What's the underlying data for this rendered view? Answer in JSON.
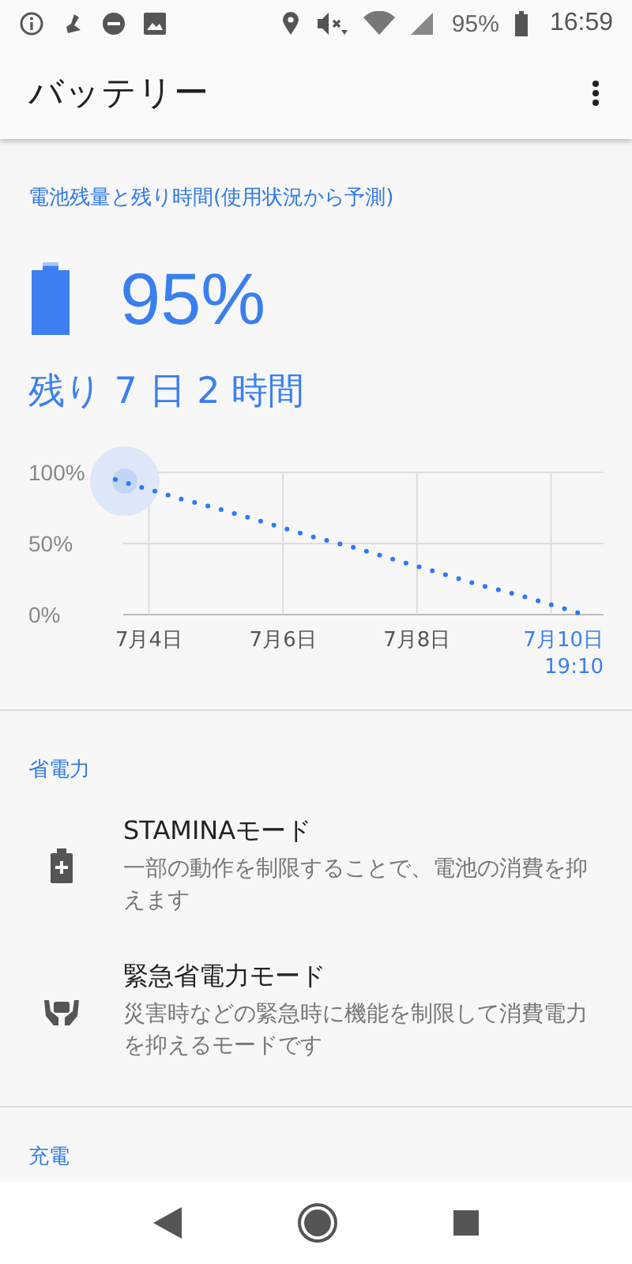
{
  "status_bar": {
    "battery": "95%",
    "time": "16:59"
  },
  "app_bar": {
    "title": "バッテリー"
  },
  "battery_section": {
    "title": "電池残量と残り時間(使用状況から予測)",
    "percent": "95%",
    "level": 0.95,
    "remaining": "残り 7 日 2 時間",
    "chart_data": {
      "type": "line",
      "grid": true,
      "categories": [
        null,
        "7月4日",
        null,
        null,
        null,
        "7月6日",
        null,
        null,
        null,
        "7月8日",
        null,
        null,
        null,
        "7月10日\n19:10",
        null
      ],
      "series": [
        {
          "color": "#2979ff",
          "line_style": "dotted",
          "values": [
            95,
            88,
            81,
            75,
            68,
            61,
            54,
            48,
            41,
            34,
            27,
            20,
            14,
            7,
            0
          ]
        }
      ],
      "ylim": [
        0,
        100
      ],
      "yticks": [
        {
          "value": 0,
          "label": "0%"
        },
        {
          "value": 50,
          "label": "50%"
        },
        {
          "value": 100,
          "label": "100%"
        }
      ]
    }
  },
  "power_saving": {
    "title": "省電力",
    "items": [
      {
        "kind": "battery",
        "title": "STAMINAモード",
        "summary": "一部の動作を制限することで、電池の消費を抑えます"
      },
      {
        "kind": "hands",
        "title": "緊急省電力モード",
        "summary": "災害時などの緊急時に機能を制限して消費電力を抑えるモードです"
      }
    ]
  },
  "charging": {
    "title": "充電"
  }
}
